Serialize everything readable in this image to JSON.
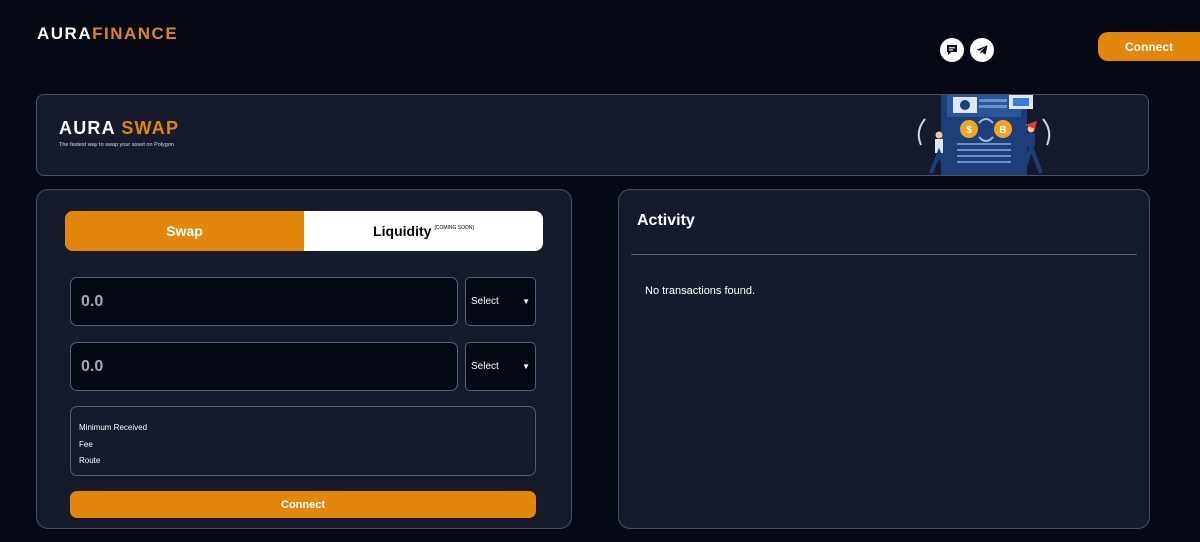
{
  "header": {
    "logo_part1": "AURA",
    "logo_part2": "FINANCE",
    "connect_label": "Connect",
    "social_icons": [
      "chat-icon",
      "telegram-icon"
    ]
  },
  "banner": {
    "title_part1": "AURA",
    "title_part2": "SWAP",
    "subtitle": "The fastest way to swap your asset on Polygon"
  },
  "swap": {
    "tab_swap": "Swap",
    "tab_liquidity": "Liquidity",
    "coming_soon": "[COMING SOON]",
    "from_placeholder": "0.0",
    "to_placeholder": "0.0",
    "from_select": "Select",
    "to_select": "Select",
    "info": {
      "min_received": "Minimum Received",
      "fee": "Fee",
      "route": "Route"
    },
    "connect_label": "Connect"
  },
  "activity": {
    "title": "Activity",
    "empty_text": "No transactions found."
  },
  "colors": {
    "accent": "#e2870b",
    "background": "#050914",
    "panel": "#161b2c"
  }
}
